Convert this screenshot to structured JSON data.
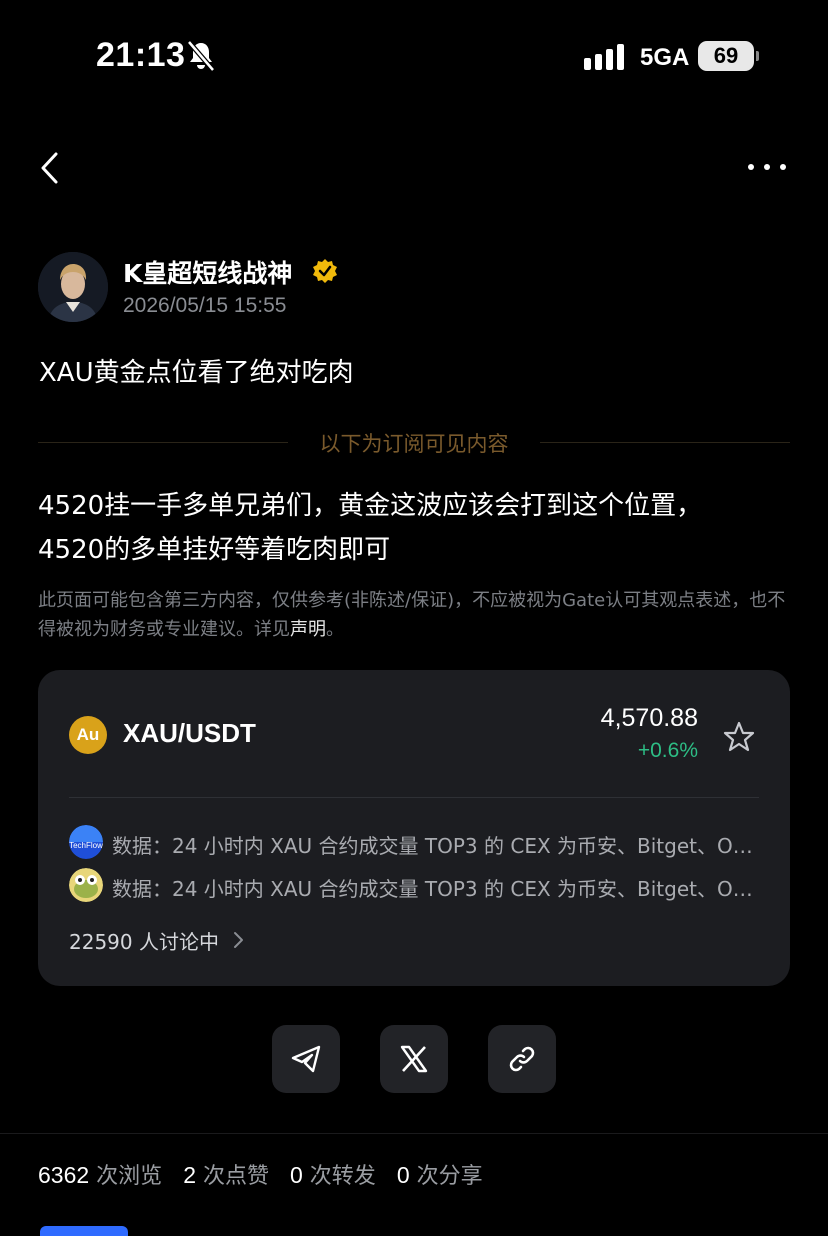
{
  "status_bar": {
    "time": "21:13",
    "network": "5GA",
    "battery": "69"
  },
  "author": {
    "name": "K皇超短线战神",
    "timestamp": "2026/05/15 15:55"
  },
  "post": {
    "title": "XAU黄金点位看了绝对吃肉",
    "divider_label": "以下为订阅可见内容",
    "content_line1": "4520挂一手多单兄弟们，黄金这波应该会打到这个位置，",
    "content_line2": "4520的多单挂好等着吃肉即可",
    "disclaimer_text": "此页面可能包含第三方内容，仅供参考(非陈述/保证)，不应被视为Gate认可其观点表述，也不得被视为财务或专业建议。详见",
    "disclaimer_link": "声明",
    "disclaimer_end": "。"
  },
  "card": {
    "coin_icon_label": "Au",
    "pair": "XAU/USDT",
    "price": "4,570.88",
    "change": "+0.6%",
    "news": [
      {
        "text": "数据：24 小时内 XAU 合约成交量 TOP3 的 CEX 为币安、Bitget、O…",
        "icon": "techflow-logo-icon",
        "icon_label": "TechFlow"
      },
      {
        "text": "数据：24 小时内 XAU 合约成交量 TOP3 的 CEX 为币安、Bitget、O…",
        "icon": "frog-avatar-icon"
      }
    ],
    "discussion": "22590 人讨论中"
  },
  "share_buttons": [
    "telegram-icon",
    "x-icon",
    "link-icon"
  ],
  "stats": {
    "views_count": "6362",
    "views_label": "次浏览",
    "likes_count": "2",
    "likes_label": "次点赞",
    "reposts_count": "0",
    "reposts_label": "次转发",
    "shares_count": "0",
    "shares_label": "次分享"
  },
  "colors": {
    "accent_gold": "#7a5a2c",
    "positive": "#2dbd85",
    "coin": "#d9a21a",
    "verified": "#f0b90b"
  }
}
